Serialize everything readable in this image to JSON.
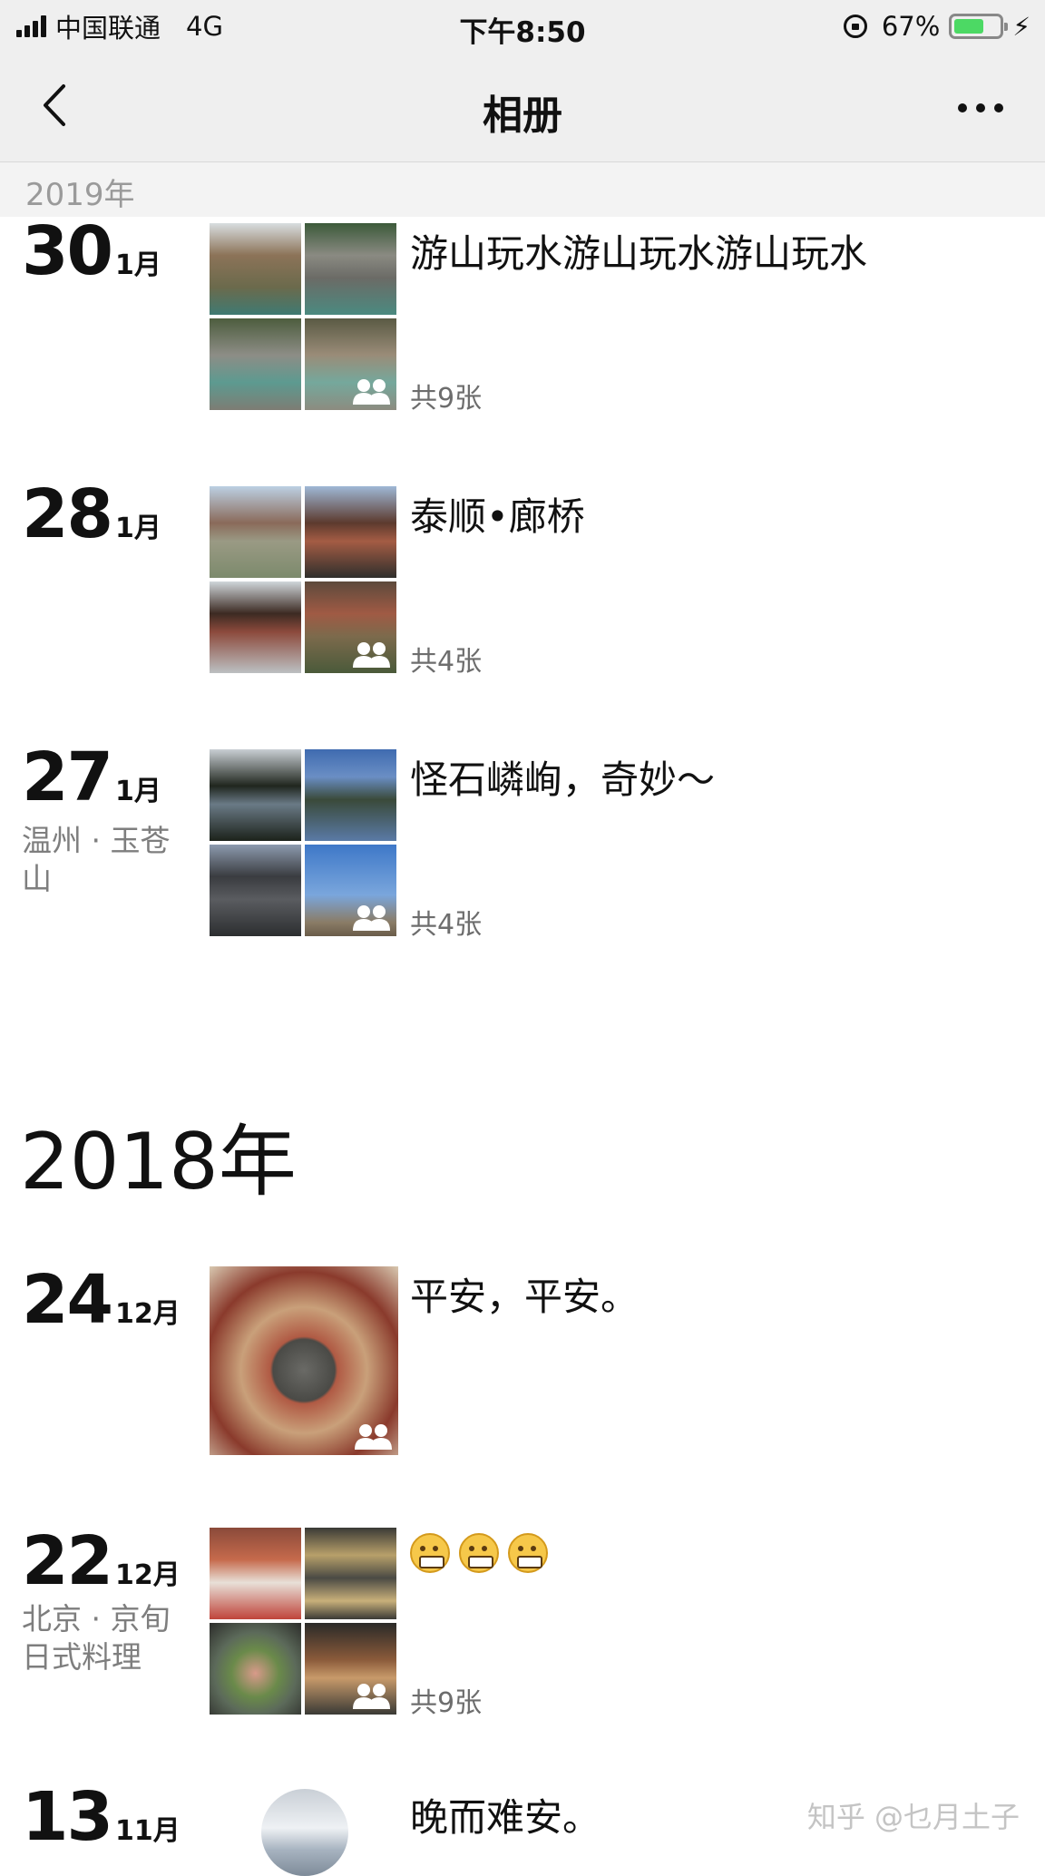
{
  "status_bar": {
    "carrier": "中国联通",
    "network": "4G",
    "time": "下午8:50",
    "battery_percent": "67%",
    "battery_level": 0.67,
    "battery_color": "#4cd964"
  },
  "nav": {
    "title": "相册",
    "back_icon": "chevron-left-icon",
    "more_icon": "ellipsis-icon"
  },
  "sticky_year": "2019年",
  "entries_2019": [
    {
      "day": "30",
      "month": "1月",
      "location": "",
      "caption": "游山玩水游山玩水游山玩水",
      "count": "共9张"
    },
    {
      "day": "28",
      "month": "1月",
      "location": "",
      "caption": "泰顺•廊桥",
      "count": "共4张"
    },
    {
      "day": "27",
      "month": "1月",
      "location": "温州 · 玉苍山",
      "caption": "怪石嶙峋，奇妙～",
      "count": "共4张"
    }
  ],
  "year_2018": "2018年",
  "entries_2018": [
    {
      "day": "24",
      "month": "12月",
      "location": "",
      "caption": "平安，平安。",
      "count": ""
    },
    {
      "day": "22",
      "month": "12月",
      "location": "北京 · 京旬日式料理",
      "caption": "",
      "emoji_count": 3,
      "count": "共9张"
    },
    {
      "day": "13",
      "month": "11月",
      "location": "",
      "caption": "晚而难安。",
      "count": ""
    }
  ],
  "watermark": "知乎 @乜月土子"
}
